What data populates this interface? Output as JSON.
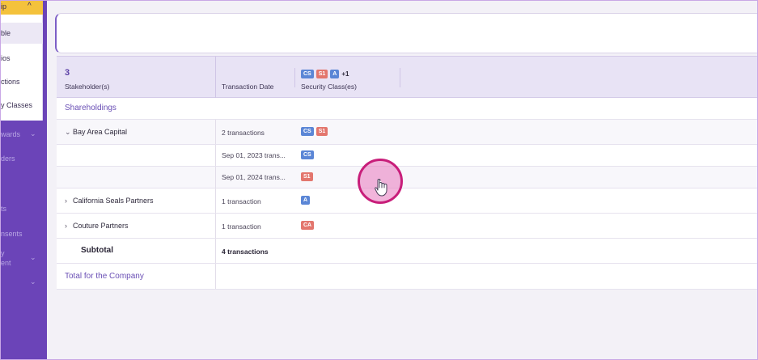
{
  "sidebar": {
    "section_title": "ip",
    "items": [
      {
        "label": "ble",
        "active": true
      },
      {
        "label": "ios"
      },
      {
        "label": "ctions"
      },
      {
        "label": "y Classes"
      }
    ],
    "purple_items": [
      {
        "label": "wards",
        "has_chevron": true
      },
      {
        "label": "ders"
      },
      {
        "label": "ts"
      },
      {
        "label": "nsents"
      },
      {
        "label": "y"
      },
      {
        "label": "ent",
        "has_chevron": true
      },
      {
        "label": "",
        "has_chevron": true
      }
    ]
  },
  "table": {
    "header": {
      "count": "3",
      "stakeholders_label": "Stakeholder(s)",
      "transaction_date_label": "Transaction Date",
      "security_classes_label": "Security Class(es)",
      "badges": [
        "CS",
        "S1",
        "A"
      ],
      "more": "+1"
    },
    "shareholdings_title": "Shareholdings",
    "rows": [
      {
        "name": "Bay Area Capital",
        "date": "2 transactions",
        "badges": [
          "CS",
          "S1"
        ]
      },
      {
        "name": "",
        "date": "Sep 01, 2023 trans...",
        "badges": [
          "CS"
        ]
      },
      {
        "name": "",
        "date": "Sep 01, 2024 trans...",
        "badges": [
          "S1"
        ]
      },
      {
        "name": "California Seals Partners",
        "date": "1 transaction",
        "badges": [
          "A"
        ]
      },
      {
        "name": "Couture Partners",
        "date": "1 transaction",
        "badges": [
          "CA"
        ]
      }
    ],
    "subtotal_label": "Subtotal",
    "subtotal_value": "4 transactions",
    "total_label": "Total for the Company"
  },
  "colors": {
    "sidebar": "#6b44b8",
    "accent": "#f4c23c",
    "header_bg": "#e8e3f5",
    "badge_blue": "#5b86d6",
    "badge_red": "#e3766d",
    "cursor_ring": "#c81e7a"
  }
}
